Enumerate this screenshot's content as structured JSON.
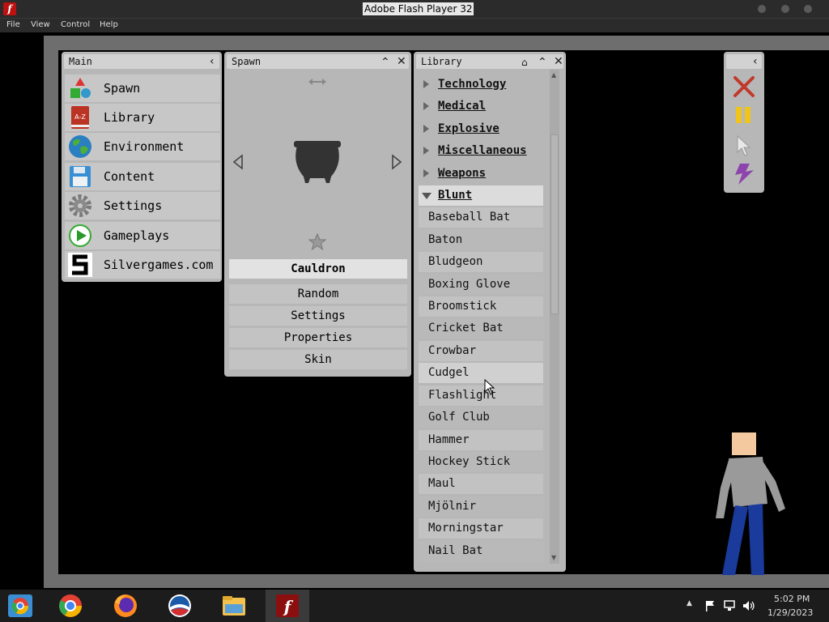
{
  "window": {
    "title": "Adobe Flash Player 32"
  },
  "menubar": {
    "items": [
      "File",
      "View",
      "Control",
      "Help"
    ]
  },
  "main_panel": {
    "title": "Main",
    "items": [
      {
        "label": "Spawn",
        "icon": "shapes-icon"
      },
      {
        "label": "Library",
        "icon": "book-icon"
      },
      {
        "label": "Environment",
        "icon": "globe-icon"
      },
      {
        "label": "Content",
        "icon": "floppy-disk-icon"
      },
      {
        "label": "Settings",
        "icon": "gear-icon"
      },
      {
        "label": "Gameplays",
        "icon": "play-icon"
      },
      {
        "label": "Silvergames.com",
        "icon": "silvergames-logo-icon"
      }
    ]
  },
  "spawn_panel": {
    "title": "Spawn",
    "selected_item": "Cauldron",
    "buttons": [
      "Random",
      "Settings",
      "Properties",
      "Skin"
    ]
  },
  "library_panel": {
    "title": "Library",
    "categories": [
      "Technology",
      "Medical",
      "Explosive",
      "Miscellaneous",
      "Weapons"
    ],
    "open_category": "Blunt",
    "items": [
      "Baseball Bat",
      "Baton",
      "Bludgeon",
      "Boxing Glove",
      "Broomstick",
      "Cricket Bat",
      "Crowbar",
      "Cudgel",
      "Flashlight",
      "Golf Club",
      "Hammer",
      "Hockey Stick",
      "Maul",
      "Mjölnir",
      "Morningstar",
      "Nail Bat"
    ],
    "hovered_item": "Cudgel"
  },
  "tools_panel": {
    "tools": [
      "clear-icon",
      "pause-icon",
      "pointer-icon",
      "power-icon"
    ]
  },
  "taskbar": {
    "apps": [
      "chrome-app-icon",
      "chrome-icon",
      "firefox-icon",
      "obama-icon",
      "file-explorer-icon",
      "flash-player-icon"
    ],
    "time": "5:02 PM",
    "date": "1/29/2023"
  },
  "colors": {
    "panel": "#b7b7b7",
    "stage_border": "#6e6e6e",
    "pause_yellow": "#f0c419",
    "close_red": "#c0392b",
    "lightning_purple": "#8e44ad"
  }
}
